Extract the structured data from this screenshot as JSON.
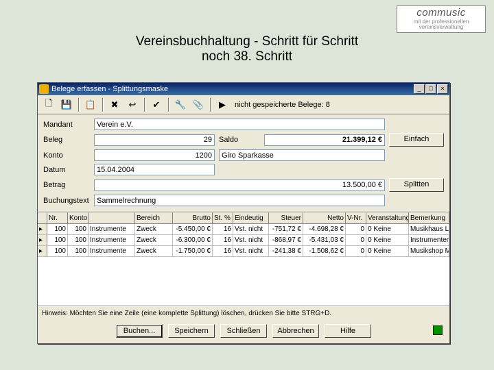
{
  "logo": {
    "brand": "commusic",
    "sub1": "mit der professionellen",
    "sub2": "vereinsverwaltung"
  },
  "headline": {
    "line1": "Vereinsbuchhaltung - Schritt für Schritt",
    "line2": "noch 38. Schritt"
  },
  "window": {
    "title": "Belege erfassen - Splittungsmaske",
    "winbtns": {
      "min": "_",
      "max": "□",
      "close": "×"
    }
  },
  "toolbar": {
    "icons": {
      "new": "🗋",
      "save": "💾",
      "paste": "📋",
      "delete": "✖",
      "back": "↩",
      "conf": "✔",
      "tool": "🔧",
      "attach": "📎",
      "run": "▶"
    },
    "info": "nicht gespeicherte Belege: 8"
  },
  "form": {
    "mandant_l": "Mandant",
    "mandant_v": "Verein e.V.",
    "beleg_l": "Beleg",
    "beleg_v": "29",
    "saldo_l": "Saldo",
    "saldo_v": "21.399,12 €",
    "konto_l": "Konto",
    "konto_v": "1200",
    "konto_txt": "Giro Sparkasse",
    "datum_l": "Datum",
    "datum_v": "15.04.2004",
    "betrag_l": "Betrag",
    "betrag_v": "13.500,00 €",
    "btext_l": "Buchungstext",
    "btext_v": "Sammelrechnung",
    "btn_einfach": "Einfach",
    "btn_splitten": "Splitten"
  },
  "grid": {
    "headers": {
      "nr": "Nr.",
      "k1": "Konto",
      "k2": "",
      "bereich": "Bereich",
      "brutto": "Brutto",
      "stpct": "St. %",
      "eind": "Eindeutig",
      "steuer": "Steuer",
      "netto": "Netto",
      "vnr": "V-Nr.",
      "veranst": "Veranstaltung",
      "bemerk": "Bemerkung"
    },
    "rows": [
      {
        "nr": "100",
        "k1": "100",
        "k2": "Instrumente",
        "bereich": "Zweck",
        "brutto": "-5.450,00 €",
        "stpct": "16",
        "eind": "Vst. nicht",
        "steuer": "-751,72 €",
        "netto": "-4.698,28 €",
        "vnr": "0",
        "veranst": "0  Keine",
        "bemerk": "Musikhaus Lüge"
      },
      {
        "nr": "100",
        "k1": "100",
        "k2": "Instrumente",
        "bereich": "Zweck",
        "brutto": "-6.300,00 €",
        "stpct": "16",
        "eind": "Vst. nicht",
        "steuer": "-868,97 €",
        "netto": "-5.431,03 €",
        "vnr": "0",
        "veranst": "0  Keine",
        "bemerk": "Instrumentenbauer"
      },
      {
        "nr": "100",
        "k1": "100",
        "k2": "Instrumente",
        "bereich": "Zweck",
        "brutto": "-1.750,00 €",
        "stpct": "16",
        "eind": "Vst. nicht",
        "steuer": "-241,38 €",
        "netto": "-1.508,62 €",
        "vnr": "0",
        "veranst": "0  Keine",
        "bemerk": "Musikshop Müller"
      }
    ]
  },
  "hint": "Hinweis: Möchten Sie eine Zeile (eine komplette Splittung) löschen, drücken Sie bitte STRG+D.",
  "footer": {
    "buchen": "Buchen...",
    "speichern": "Speichern",
    "schliessen": "Schließen",
    "abbrechen": "Abbrechen",
    "hilfe": "Hilfe"
  }
}
